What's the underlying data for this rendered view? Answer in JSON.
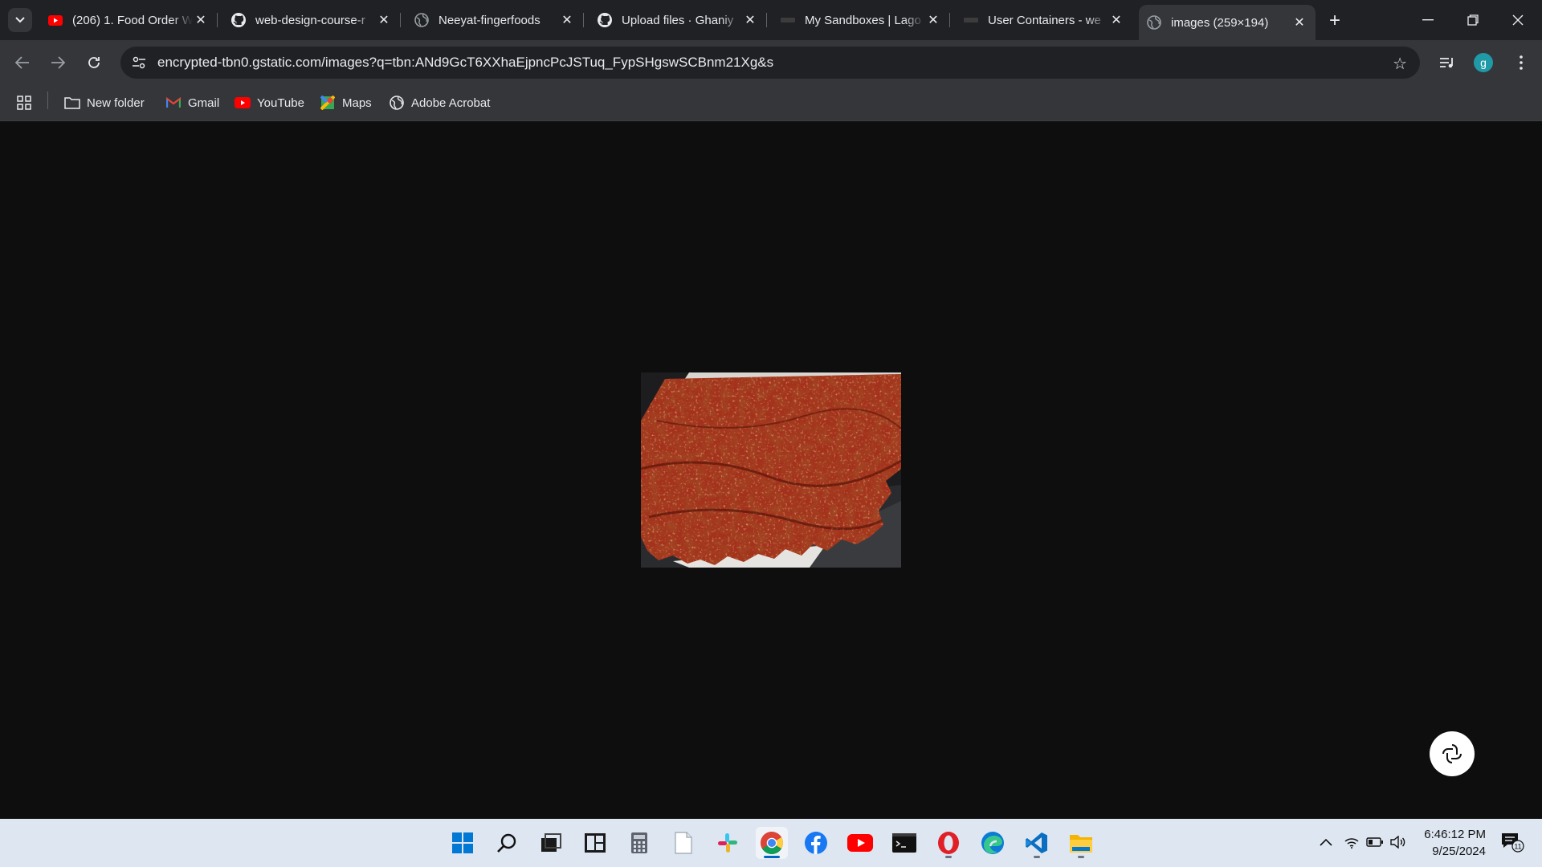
{
  "browser": {
    "tabs": [
      {
        "title": "(206) 1. Food Order W",
        "favicon": "youtube-icon"
      },
      {
        "title": "web-design-course-r",
        "favicon": "github-icon"
      },
      {
        "title": "Neeyat-fingerfoods",
        "favicon": "globe-icon"
      },
      {
        "title": "Upload files · Ghaniy",
        "favicon": "github-icon"
      },
      {
        "title": "My Sandboxes | Lago",
        "favicon": "lago-icon"
      },
      {
        "title": "User Containers - we",
        "favicon": "lago-icon"
      },
      {
        "title": "images (259×194)",
        "favicon": "globe-icon",
        "active": true
      }
    ],
    "address": "encrypted-tbn0.gstatic.com/images?q=tbn:ANd9GcT6XXhaEjpncPcJSTuq_FypSHgswSCBnm21Xg&s",
    "profile_initial": "g",
    "bookmarks": [
      {
        "label": "New folder",
        "icon": "folder-icon"
      },
      {
        "label": "Gmail",
        "icon": "gmail-icon"
      },
      {
        "label": "YouTube",
        "icon": "youtube-icon"
      },
      {
        "label": "Maps",
        "icon": "maps-icon"
      },
      {
        "label": "Adobe Acrobat",
        "icon": "globe-icon"
      }
    ]
  },
  "content": {
    "image_subject": "spicy-meat-jerky-photo"
  },
  "taskbar": {
    "apps": [
      "windows-start-icon",
      "search-icon",
      "task-view-icon",
      "widgets-icon",
      "calculator-icon",
      "notepad-icon",
      "slack-icon",
      "chrome-icon",
      "facebook-icon",
      "youtube-icon",
      "terminal-icon",
      "opera-icon",
      "edge-icon",
      "vscode-icon",
      "file-explorer-icon"
    ],
    "time": "6:46:12 PM",
    "date": "9/25/2024",
    "notification_count": "11"
  }
}
